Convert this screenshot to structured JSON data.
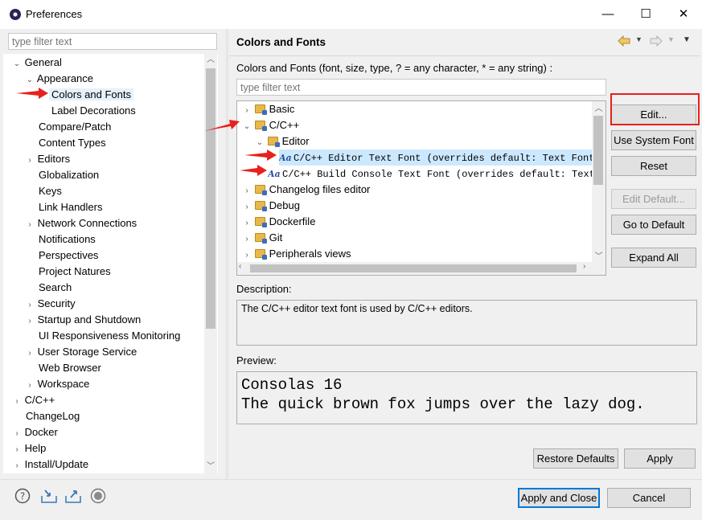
{
  "window": {
    "title": "Preferences",
    "minimize": "—",
    "maximize": "☐",
    "close": "✕"
  },
  "left": {
    "filter_placeholder": "type filter text",
    "tree": [
      {
        "label": "General",
        "twisty": "⌄"
      },
      {
        "label": "Appearance",
        "twisty": "⌄"
      },
      {
        "label": "Colors and Fonts",
        "twisty": ""
      },
      {
        "label": "Label Decorations",
        "twisty": ""
      },
      {
        "label": "Compare/Patch",
        "twisty": ""
      },
      {
        "label": "Content Types",
        "twisty": ""
      },
      {
        "label": "Editors",
        "twisty": "›"
      },
      {
        "label": "Globalization",
        "twisty": ""
      },
      {
        "label": "Keys",
        "twisty": ""
      },
      {
        "label": "Link Handlers",
        "twisty": ""
      },
      {
        "label": "Network Connections",
        "twisty": "›"
      },
      {
        "label": "Notifications",
        "twisty": ""
      },
      {
        "label": "Perspectives",
        "twisty": ""
      },
      {
        "label": "Project Natures",
        "twisty": ""
      },
      {
        "label": "Search",
        "twisty": ""
      },
      {
        "label": "Security",
        "twisty": "›"
      },
      {
        "label": "Startup and Shutdown",
        "twisty": "›"
      },
      {
        "label": "UI Responsiveness Monitoring",
        "twisty": ""
      },
      {
        "label": "User Storage Service",
        "twisty": "›"
      },
      {
        "label": "Web Browser",
        "twisty": ""
      },
      {
        "label": "Workspace",
        "twisty": "›"
      },
      {
        "label": "C/C++",
        "twisty": "›"
      },
      {
        "label": "ChangeLog",
        "twisty": ""
      },
      {
        "label": "Docker",
        "twisty": "›"
      },
      {
        "label": "Help",
        "twisty": "›"
      },
      {
        "label": "Install/Update",
        "twisty": "›"
      }
    ]
  },
  "right": {
    "page_title": "Colors and Fonts",
    "description": "Colors and Fonts (font, size, type, ? = any character, * = any string) :",
    "filter_placeholder": "type filter text",
    "tree": [
      {
        "label": "Basic",
        "twisty": "›"
      },
      {
        "label": "C/C++",
        "twisty": "⌄"
      },
      {
        "label": "Editor",
        "twisty": "⌄"
      },
      {
        "label": "C/C++ Editor Text Font (overrides default: Text Font)",
        "twisty": ""
      },
      {
        "label": "C/C++ Build Console Text Font (overrides default: Text",
        "twisty": ""
      },
      {
        "label": "Changelog files editor",
        "twisty": "›"
      },
      {
        "label": "Debug",
        "twisty": "›"
      },
      {
        "label": "Dockerfile",
        "twisty": "›"
      },
      {
        "label": "Git",
        "twisty": "›"
      },
      {
        "label": "Peripherals views",
        "twisty": "›"
      }
    ],
    "buttons": {
      "edit": "Edit...",
      "use_system_font": "Use System Font",
      "reset": "Reset",
      "edit_default": "Edit Default...",
      "go_to_default": "Go to Default",
      "expand_all": "Expand All"
    },
    "description_label": "Description:",
    "description_text": "The C/C++ editor text font is used by C/C++ editors.",
    "preview_label": "Preview:",
    "preview_lines": [
      "Consolas 16",
      "The quick brown fox jumps over the lazy dog."
    ],
    "restore_defaults": "Restore Defaults",
    "apply": "Apply"
  },
  "bottom": {
    "apply_and_close": "Apply and Close",
    "cancel": "Cancel"
  },
  "colors": {
    "annotation_red": "#e8201e",
    "selection": "#cce8ff",
    "default_button_border": "#0078d7"
  }
}
